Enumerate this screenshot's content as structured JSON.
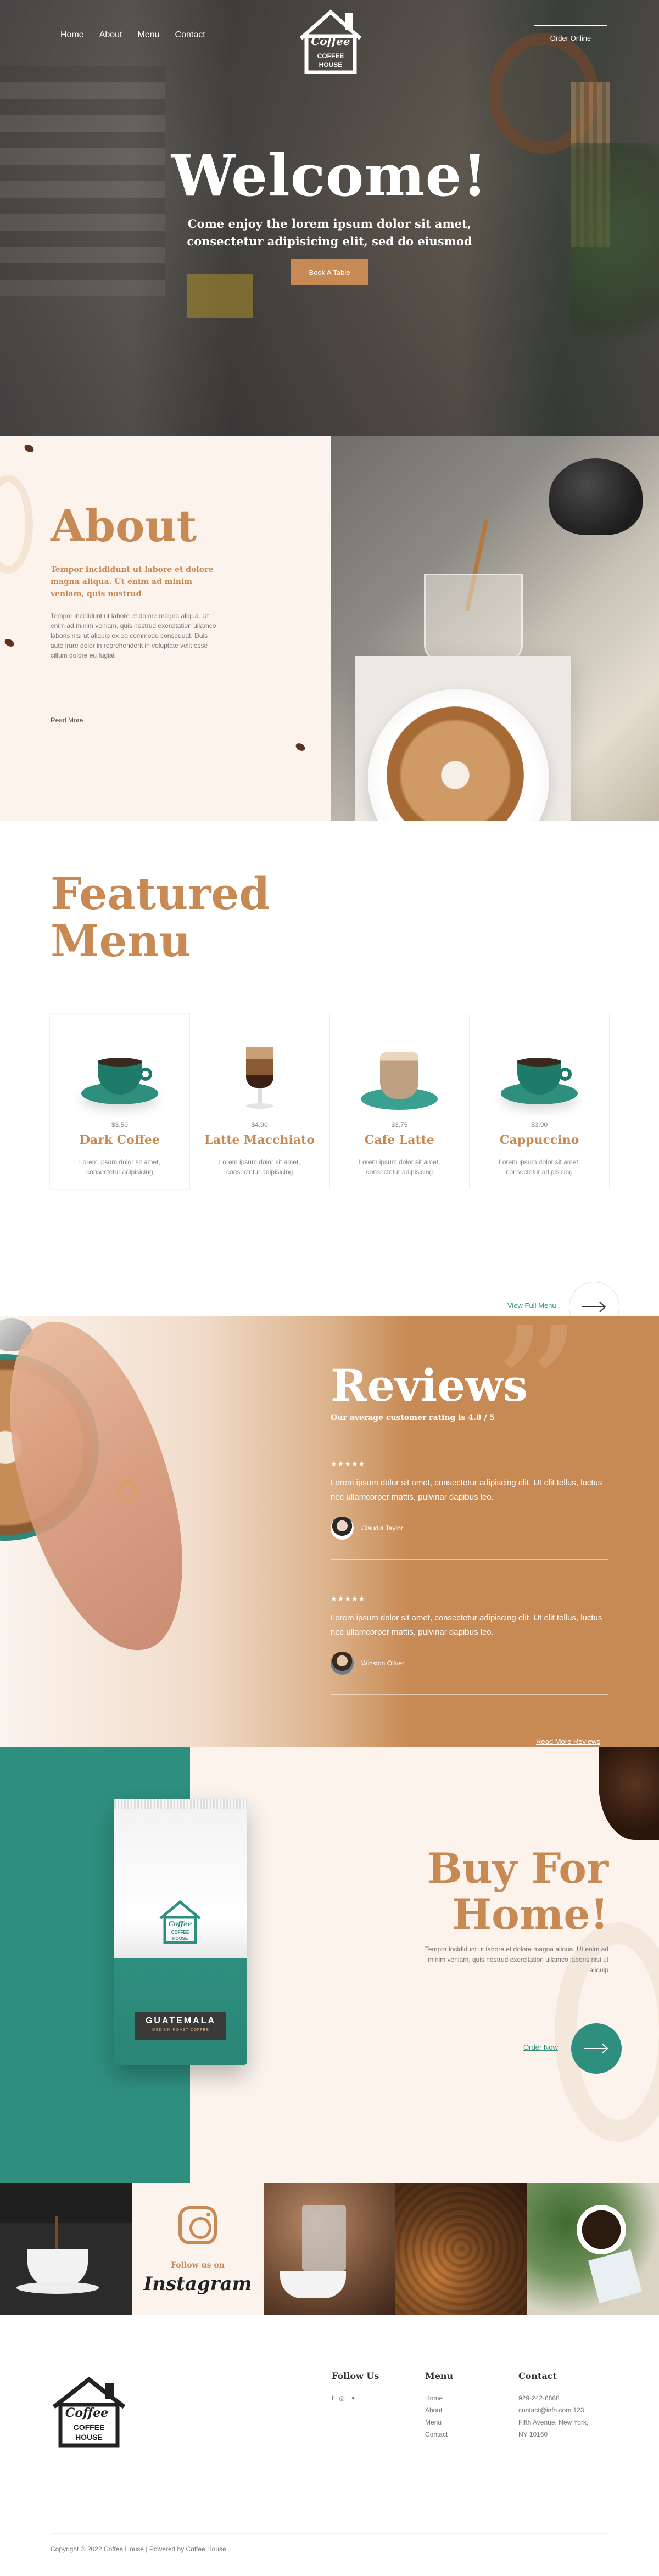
{
  "nav": {
    "items": [
      "Home",
      "About",
      "Menu",
      "Contact"
    ],
    "order_online": "Order Online"
  },
  "logo": {
    "script": "Coffee",
    "line1": "COFFEE",
    "line2": "HOUSE"
  },
  "hero": {
    "title": "Welcome!",
    "subtitle": "Come enjoy the lorem ipsum dolor sit amet, consectetur adipisicing elit, sed do eiusmod",
    "cta": "Book A Table"
  },
  "about": {
    "title": "About",
    "lead": "Tempor incididunt ut labore et dolore magna aliqua. Ut enim ad minim veniam, quis nostrud",
    "body": "Tempor incididunt ut labore et dolore magna aliqua. Ut enim ad minim veniam, quis nostrud exercitation ullamco laboris nisi ut aliquip ex ea commodo consequat. Duis aute irure dolor in reprehenderit in voluptate velit esse cillum dolore eu fugiat",
    "read_more": "Read More"
  },
  "featured": {
    "title_line1": "Featured",
    "title_line2": "Menu",
    "items": [
      {
        "price": "$3.50",
        "name": "Dark Coffee",
        "desc": "Lorem ipsum dolor sit amet, consectetur adipisicing"
      },
      {
        "price": "$4.90",
        "name": "Latte Macchiato",
        "desc": "Lorem ipsum dolor sit amet, consectetur adipisicing"
      },
      {
        "price": "$3.75",
        "name": "Cafe Latte",
        "desc": "Lorem ipsum dolor sit amet, consectetur adipisicing"
      },
      {
        "price": "$3.90",
        "name": "Cappuccino",
        "desc": "Lorem ipsum dolor sit amet, consectetur adipisicing"
      }
    ],
    "view_full": "View Full Menu"
  },
  "reviews": {
    "title": "Reviews",
    "rating": "Our average customer rating is 4.8 / 5",
    "items": [
      {
        "stars": "★★★★★",
        "text": "Lorem ipsum dolor sit amet, consectetur adipiscing elit. Ut elit tellus, luctus nec ullamcorper mattis, pulvinar dapibus leo.",
        "author": "Claudia Taylor"
      },
      {
        "stars": "★★★★★",
        "text": "Lorem ipsum dolor sit amet, consectetur adipiscing elit. Ut elit tellus, luctus nec ullamcorper mattis, pulvinar dapibus leo.",
        "author": "Winston Oliver"
      }
    ],
    "read_more": "Read More Reviews"
  },
  "buy": {
    "title_line1": "Buy For",
    "title_line2": "Home!",
    "desc": "Tempor incididunt ut labore et dolore magna aliqua. Ut enim ad minim veniam, quis nostrud exercitation ullamco laboris nisi ut aliquip",
    "order_now": "Order Now",
    "bag_label": "GUATEMALA",
    "bag_sub": "MEDIUM ROAST COFFEE"
  },
  "instagram": {
    "follow": "Follow us on",
    "brand": "Instagram"
  },
  "footer": {
    "follow_title": "Follow Us",
    "menu_title": "Menu",
    "menu_items": [
      "Home",
      "About",
      "Menu",
      "Contact"
    ],
    "contact_title": "Contact",
    "phone": "929-242-6868",
    "email": "contact@info.com 123",
    "address1": "Fifth Avenue, New York,",
    "address2": "NY 10160",
    "copyright": "Copyright © 2022 Coffee House | Powered by Coffee House"
  },
  "colors": {
    "accent": "#c88a55",
    "teal": "#2e8f7e",
    "cream": "#fcf3ec"
  }
}
